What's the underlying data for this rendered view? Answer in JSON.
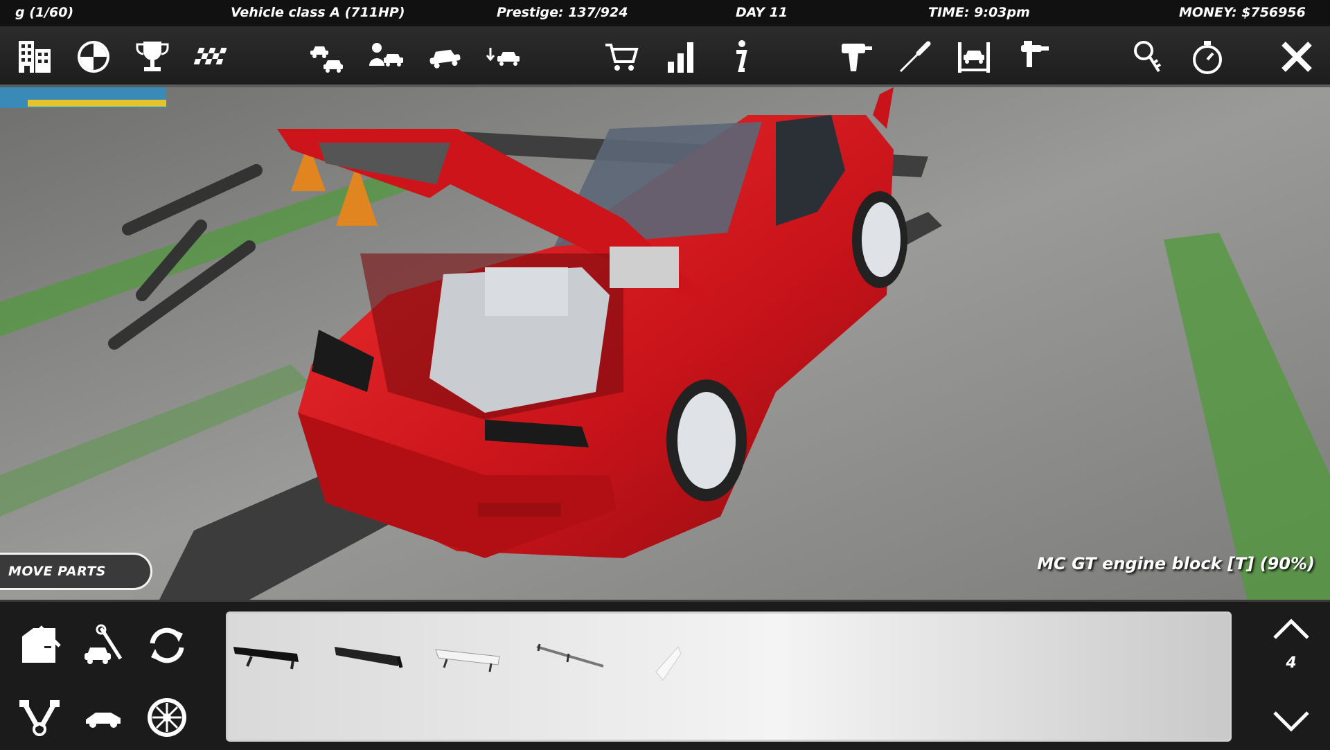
{
  "status": {
    "mission": "g (1/60)",
    "vehicle_class": "Vehicle class A (711HP)",
    "prestige": "Prestige: 137/924",
    "day": "DAY 11",
    "time": "TIME: 9:03pm",
    "money": "MONEY: $756956"
  },
  "toolbar": {
    "icons": [
      "garage-building-icon",
      "wheel-icon",
      "trophy-icon",
      "checkered-flag-icon",
      "cars-stack-icon",
      "car-dealer-icon",
      "car-crash-icon",
      "car-swap-icon",
      "shopping-cart-icon",
      "stats-bars-icon",
      "info-icon",
      "drill-icon",
      "screwdriver-icon",
      "car-lift-icon",
      "paint-gun-icon",
      "car-keys-icon",
      "stopwatch-icon",
      "close-icon"
    ]
  },
  "scene": {
    "move_parts_label": "MOVE PARTS",
    "selected_part": "MC GT engine block [T] (90%)"
  },
  "bottom": {
    "categories": [
      "car-door-icon",
      "car-repair-icon",
      "refresh-icon",
      "engine-icon",
      "car-body-icon",
      "rim-icon"
    ],
    "parts": [
      "spoiler-black-large",
      "spoiler-black-flat",
      "spoiler-white",
      "spoiler-thin-wing",
      "spoiler-white-lip"
    ],
    "page_number": "4"
  },
  "colors": {
    "car_red": "#d8161b",
    "accent_green": "#4f9a3a"
  }
}
